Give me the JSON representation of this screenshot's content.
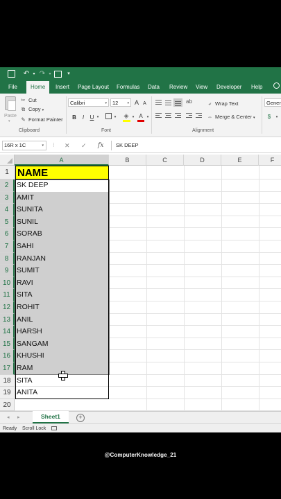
{
  "quick_access": {
    "save_icon": "save-icon",
    "undo_icon": "undo-icon",
    "redo_icon": "redo-icon",
    "form_icon": "form-icon"
  },
  "ribbon_tabs": [
    "File",
    "Home",
    "Insert",
    "Page Layout",
    "Formulas",
    "Data",
    "Review",
    "View",
    "Developer",
    "Help"
  ],
  "active_tab": "Home",
  "ribbon": {
    "paste_label": "Paste",
    "cut_label": "Cut",
    "copy_label": "Copy",
    "format_painter_label": "Format Painter",
    "clipboard_group": "Clipboard",
    "font_name": "Calibri",
    "font_size": "12",
    "grow_font": "A",
    "shrink_font": "A",
    "bold": "B",
    "italic": "I",
    "underline": "U",
    "font_color_letter": "A",
    "font_group": "Font",
    "wrap_text_label": "Wrap Text",
    "merge_center_label": "Merge & Center",
    "alignment_group": "Alignment",
    "number_format": "Genera"
  },
  "formula_bar": {
    "name_box": "16R x 1C",
    "cancel": "✕",
    "enter": "✓",
    "fx": "fx",
    "formula": "SK DEEP"
  },
  "columns": [
    "A",
    "B",
    "C",
    "D",
    "E",
    "F"
  ],
  "rows": [
    {
      "num": "1",
      "value": "NAME"
    },
    {
      "num": "2",
      "value": "SK DEEP"
    },
    {
      "num": "3",
      "value": "AMIT"
    },
    {
      "num": "4",
      "value": "SUNITA"
    },
    {
      "num": "5",
      "value": "SUNIL"
    },
    {
      "num": "6",
      "value": "SORAB"
    },
    {
      "num": "7",
      "value": "SAHI"
    },
    {
      "num": "8",
      "value": "RANJAN"
    },
    {
      "num": "9",
      "value": "SUMIT"
    },
    {
      "num": "10",
      "value": "RAVI"
    },
    {
      "num": "11",
      "value": "SITA"
    },
    {
      "num": "12",
      "value": "ROHIT"
    },
    {
      "num": "13",
      "value": "ANIL"
    },
    {
      "num": "14",
      "value": "HARSH"
    },
    {
      "num": "15",
      "value": "SANGAM"
    },
    {
      "num": "16",
      "value": "KHUSHI"
    },
    {
      "num": "17",
      "value": "RAM"
    },
    {
      "num": "18",
      "value": "SITA"
    },
    {
      "num": "19",
      "value": "ANITA"
    },
    {
      "num": "20",
      "value": ""
    }
  ],
  "sheet_tab": "Sheet1",
  "status": {
    "ready": "Ready",
    "scroll_lock": "Scroll Lock"
  },
  "watermark": "@ComputerKnowledge_21",
  "colors": {
    "excel_green": "#217346",
    "header_fill": "#ffff00",
    "selection_fill": "#cfcfcf"
  }
}
